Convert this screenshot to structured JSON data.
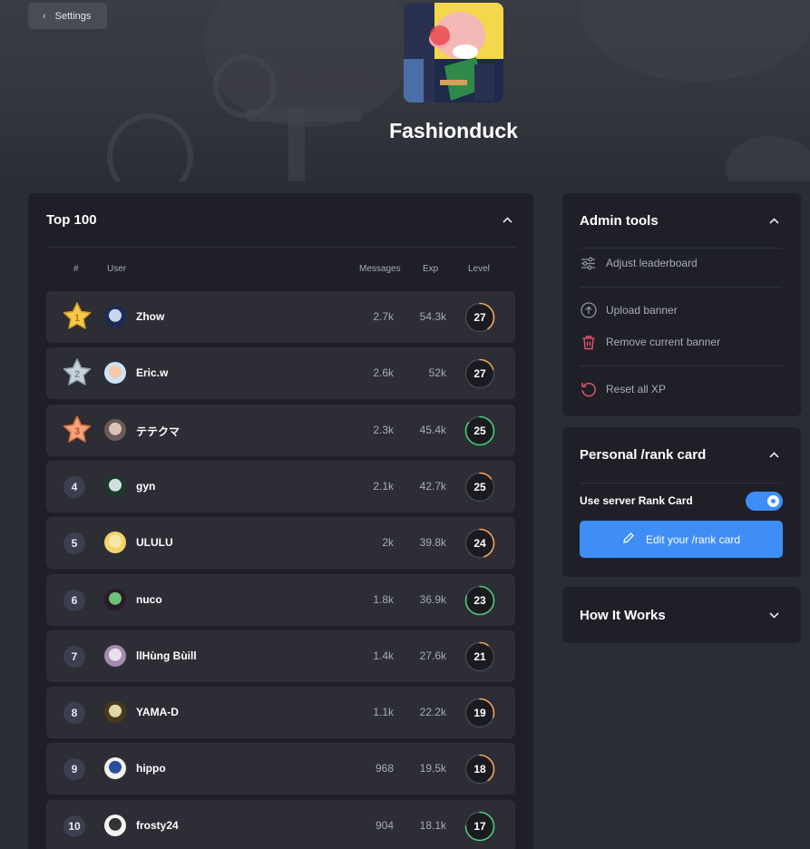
{
  "header": {
    "back_label": "Settings",
    "server_name": "Fashionduck"
  },
  "leaderboard": {
    "title": "Top 100",
    "columns": {
      "rank": "#",
      "user": "User",
      "messages": "Messages",
      "exp": "Exp",
      "level": "Level"
    },
    "rows": [
      {
        "rank": "1",
        "user": "Zhow",
        "messages": "2.7k",
        "exp": "54.3k",
        "level": "27",
        "progress": 0.4,
        "ring_color": "#f0a45b",
        "medal": "gold"
      },
      {
        "rank": "2",
        "user": "Eric.w",
        "messages": "2.6k",
        "exp": "52k",
        "level": "27",
        "progress": 0.2,
        "ring_color": "#f0a45b",
        "medal": "silver"
      },
      {
        "rank": "3",
        "user": "テテクマ",
        "messages": "2.3k",
        "exp": "45.4k",
        "level": "25",
        "progress": 0.85,
        "ring_color": "#4cc97a",
        "medal": "bronze"
      },
      {
        "rank": "4",
        "user": "gyn",
        "messages": "2.1k",
        "exp": "42.7k",
        "level": "25",
        "progress": 0.15,
        "ring_color": "#f0a45b",
        "medal": ""
      },
      {
        "rank": "5",
        "user": "ULULU",
        "messages": "2k",
        "exp": "39.8k",
        "level": "24",
        "progress": 0.45,
        "ring_color": "#f0a45b",
        "medal": ""
      },
      {
        "rank": "6",
        "user": "nuco",
        "messages": "1.8k",
        "exp": "36.9k",
        "level": "23",
        "progress": 0.8,
        "ring_color": "#4cc97a",
        "medal": ""
      },
      {
        "rank": "7",
        "user": "llHùng Bùill",
        "messages": "1.4k",
        "exp": "27.6k",
        "level": "21",
        "progress": 0.1,
        "ring_color": "#f0a45b",
        "medal": ""
      },
      {
        "rank": "8",
        "user": "YAMA-D",
        "messages": "1.1k",
        "exp": "22.2k",
        "level": "19",
        "progress": 0.3,
        "ring_color": "#f0a45b",
        "medal": ""
      },
      {
        "rank": "9",
        "user": "hippo",
        "messages": "968",
        "exp": "19.5k",
        "level": "18",
        "progress": 0.4,
        "ring_color": "#f0a45b",
        "medal": ""
      },
      {
        "rank": "10",
        "user": "frosty24",
        "messages": "904",
        "exp": "18.1k",
        "level": "17",
        "progress": 0.75,
        "ring_color": "#4cc97a",
        "medal": ""
      }
    ]
  },
  "admin_tools": {
    "title": "Admin tools",
    "adjust_leaderboard": "Adjust leaderboard",
    "upload_banner": "Upload banner",
    "remove_banner": "Remove current banner",
    "reset_xp": "Reset all XP"
  },
  "rank_card": {
    "title": "Personal /rank card",
    "toggle_label": "Use server Rank Card",
    "toggle_on": true,
    "edit_label": "Edit your /rank card"
  },
  "how_it_works": {
    "title": "How It Works"
  },
  "colors": {
    "accent": "#3f8ef7",
    "danger": "#e0546a",
    "progress_orange": "#f0a45b",
    "progress_green": "#4cc97a"
  }
}
